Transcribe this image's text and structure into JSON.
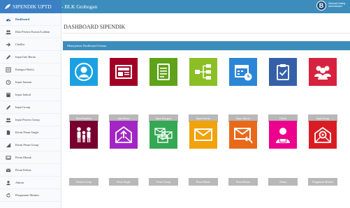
{
  "app": {
    "brand": "SIPENDIK UPTD",
    "subtitle": "- BLK Grobogan",
    "avatar_letter": "B",
    "user_line1": "Selamat Datang",
    "user_line2": "Administrator"
  },
  "sidebar": {
    "items": [
      {
        "label": "Dashboard",
        "icon": "dashboard-icon",
        "active": true
      },
      {
        "label": "Data Peserta Kursus/Latihan",
        "icon": "users-icon"
      },
      {
        "label": "Chellist",
        "icon": "arrow-right-icon"
      },
      {
        "label": "Input Info Berita",
        "icon": "pencil-icon"
      },
      {
        "label": "Kategori Berita",
        "icon": "list-icon"
      },
      {
        "label": "Input Jurusan",
        "icon": "circle-icon"
      },
      {
        "label": "Input Jadwal",
        "icon": "book-icon"
      },
      {
        "label": "Input Group",
        "icon": "pencil-icon"
      },
      {
        "label": "Input Peserta Group",
        "icon": "users-icon"
      },
      {
        "label": "Kirim Pesan Single",
        "icon": "file-icon"
      },
      {
        "label": "Kirim Pesan Group",
        "icon": "bar-chart-icon"
      },
      {
        "label": "Pesan Masuk",
        "icon": "inbox-icon"
      },
      {
        "label": "Pesan Keluar",
        "icon": "envelope-icon"
      },
      {
        "label": "Admin",
        "icon": "user-icon"
      },
      {
        "label": "Pengaturan Modem",
        "icon": "refresh-icon"
      }
    ]
  },
  "main": {
    "page_title": "DASHBOARD SIPENDIK",
    "panel_title": "Manajemen Dashboard Utama",
    "row1": [
      {
        "label": "Data Pendaftar",
        "icon": "person-circle-icon",
        "color": "#1ba1e2"
      },
      {
        "label": "Info Berita",
        "icon": "news-icon",
        "color": "#a20025"
      },
      {
        "label": "Input Kategori",
        "icon": "document-list-icon",
        "color": "#5fa318"
      },
      {
        "label": "Input Jurusan",
        "icon": "hierarchy-icon",
        "color": "#8cbf26"
      },
      {
        "label": "Input Jadwal",
        "icon": "calendar-icon",
        "color": "#2b86d6"
      },
      {
        "label": "Check",
        "icon": "clipboard-check-icon",
        "color": "#3560a8"
      },
      {
        "label": "Input Group",
        "icon": "group-icon",
        "color": "#d6223e"
      }
    ],
    "row2": [
      {
        "label": "Peserta Group",
        "icon": "family-icon",
        "color": "#780030"
      },
      {
        "label": "Pesan Single",
        "icon": "envelope-up-icon",
        "color": "#a326c4"
      },
      {
        "label": "Pesan Group",
        "icon": "envelopes-icon",
        "color": "#34a853"
      },
      {
        "label": "Pesan Masuk",
        "icon": "envelope-icon",
        "color": "#f0a30a"
      },
      {
        "label": "Pesan Keluar",
        "icon": "envelope-reply-icon",
        "color": "#e9691a"
      },
      {
        "label": "Admin",
        "icon": "admin-icon",
        "color": "#ec008c"
      },
      {
        "label": "Pengaturan Modem",
        "icon": "settings-mail-icon",
        "color": "#d91c24"
      }
    ]
  }
}
